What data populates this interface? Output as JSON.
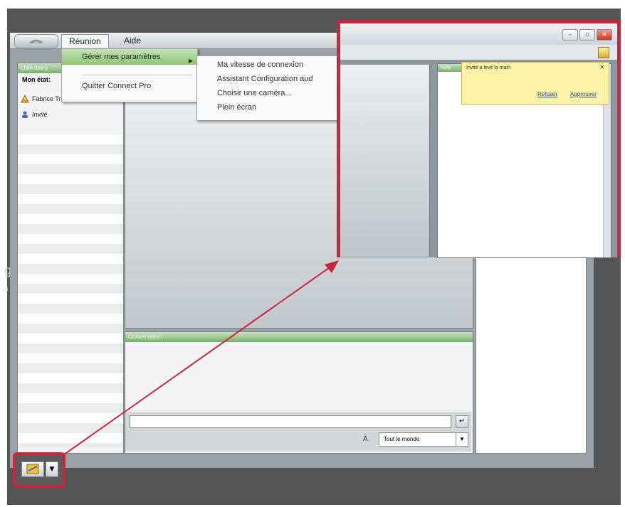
{
  "stray_text": {
    "large": "g",
    "small": "ui"
  },
  "menubar": {
    "items": [
      "Réunion",
      "Aide"
    ]
  },
  "reunion_menu": {
    "items": [
      "Gérer mes paramètres",
      "Quitter Connect Pro"
    ]
  },
  "settings_submenu": {
    "items": [
      "Ma vitesse de connexion",
      "Assistant Configuration aud",
      "Choisir une caméra...",
      "Plein écran"
    ]
  },
  "attendees_panel": {
    "title": "Liste des p",
    "my_status_label": "Mon état:",
    "attendees": [
      {
        "name": "Fabrice Trillaud",
        "icon": "host-warning-icon",
        "color": "#e1a11b"
      },
      {
        "name": "Invité",
        "icon": "guest-person-icon",
        "color": "#3c6fc2"
      }
    ]
  },
  "share_panel": {
    "title": ""
  },
  "chat_panel": {
    "title": "Conversation",
    "to_label": "À",
    "to_value": "Tout le monde"
  },
  "notes_panel": {
    "title": "Note"
  },
  "zoom_window": {
    "notification": {
      "message": "Invité a levé la main",
      "close": "×",
      "action_1": "Refuser",
      "action_2": "Approuver"
    }
  },
  "bottom_toolbar": {
    "raise_hand_icon": "raise-hand-icon",
    "dropdown_icon": "dropdown-arrow-icon"
  },
  "colors": {
    "highlight": "#c8263f",
    "panel_header": "#78b06b",
    "dark_bg": "#555555"
  }
}
